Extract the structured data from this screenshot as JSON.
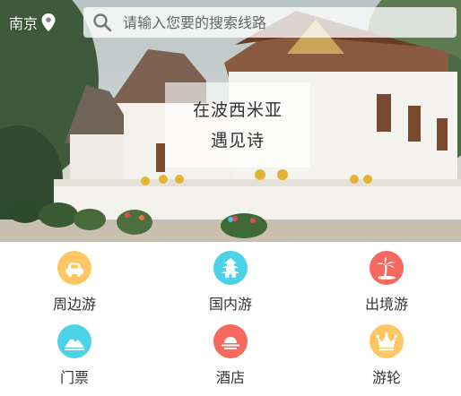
{
  "location": {
    "city": "南京"
  },
  "search": {
    "placeholder": "请输入您要的搜索线路"
  },
  "banner": {
    "caption_line1": "在波西米亚",
    "caption_line2": "遇见诗",
    "slide_count": 1,
    "active_slide": 0
  },
  "categories": [
    {
      "label": "周边游",
      "icon": "car-icon",
      "color": "#ffc764"
    },
    {
      "label": "国内游",
      "icon": "pagoda-icon",
      "color": "#4dd3e8"
    },
    {
      "label": "出境游",
      "icon": "palm-tree-icon",
      "color": "#f6695e"
    },
    {
      "label": "门票",
      "icon": "mountain-icon",
      "color": "#4dd3e8"
    },
    {
      "label": "酒店",
      "icon": "sunrise-icon",
      "color": "#f6695e"
    },
    {
      "label": "游轮",
      "icon": "crown-icon",
      "color": "#ffc764"
    }
  ]
}
